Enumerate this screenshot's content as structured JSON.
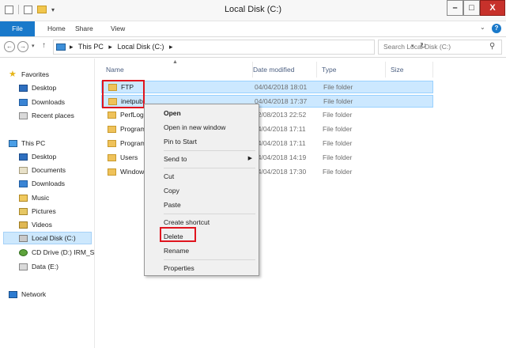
{
  "window": {
    "title": "Local Disk (C:)",
    "controls": {
      "minimize": "–",
      "maximize": "□",
      "close": "X"
    }
  },
  "ribbon": {
    "tabs": [
      "File",
      "Home",
      "Share",
      "View"
    ],
    "expand": "⌄",
    "help": "?"
  },
  "address": {
    "crumbs": [
      "This PC",
      "▸",
      "Local Disk (C:)",
      "▸"
    ],
    "separator_leading": "▸",
    "search_placeholder": "Search Local Disk (C:)"
  },
  "nav_pane": {
    "favorites": {
      "label": "Favorites",
      "items": [
        "Desktop",
        "Downloads",
        "Recent places"
      ]
    },
    "this_pc": {
      "label": "This PC",
      "items": [
        "Desktop",
        "Documents",
        "Downloads",
        "Music",
        "Pictures",
        "Videos",
        "Local Disk (C:)",
        "CD Drive (D:) IRM_SS",
        "Data (E:)"
      ]
    },
    "network": {
      "label": "Network"
    }
  },
  "columns": {
    "name": "Name",
    "date": "Date modified",
    "type": "Type",
    "size": "Size"
  },
  "files": [
    {
      "name": "FTP",
      "date": "04/04/2018 18:01",
      "type": "File folder"
    },
    {
      "name": "inetpub",
      "date": "04/04/2018 17:37",
      "type": "File folder"
    },
    {
      "name": "PerfLogs",
      "date": "22/08/2013 22:52",
      "type": "File folder"
    },
    {
      "name": "Program",
      "date": "04/04/2018 17:11",
      "type": "File folder"
    },
    {
      "name": "Program",
      "date": "04/04/2018 17:11",
      "type": "File folder"
    },
    {
      "name": "Users",
      "date": "04/04/2018 14:19",
      "type": "File folder"
    },
    {
      "name": "Windows",
      "date": "04/04/2018 17:30",
      "type": "File folder"
    }
  ],
  "context_menu": {
    "open": "Open",
    "open_new_window": "Open in new window",
    "pin_to_start": "Pin to Start",
    "send_to": "Send to",
    "cut": "Cut",
    "copy": "Copy",
    "paste": "Paste",
    "create_shortcut": "Create shortcut",
    "delete": "Delete",
    "rename": "Rename",
    "properties": "Properties"
  }
}
